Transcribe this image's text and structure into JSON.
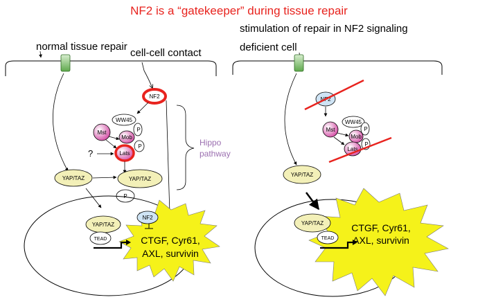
{
  "title": "NF2 is a “gatekeeper” during tissue repair",
  "left_panel": {
    "heading": "normal tissue repair",
    "contact_label": "cell-cell contact",
    "nf2": "NF2",
    "ww45": "WW45",
    "mst": "Mst",
    "mob": "Mob",
    "lats": "Lats",
    "p1": "P",
    "p2": "P",
    "p3": "P",
    "question": "?",
    "yaptaz_cyto": "YAP/TAZ",
    "yaptaz_phos": "YAP/TAZ",
    "yaptaz_nuc": "YAP/TAZ",
    "nf2_nuc": "NF2",
    "tead": "TEAD",
    "hippo_line1": "Hippo",
    "hippo_line2": "pathway",
    "targets": [
      "CTGF, Cyr61,",
      "AXL, survivin"
    ]
  },
  "right_panel": {
    "heading_line1": "stimulation of repair in NF2 signaling",
    "heading_line2": "deficient cell",
    "nf2": "NF2",
    "ww45": "WW45",
    "mst": "Mst",
    "mob": "Mob",
    "lats": "Lats",
    "p1": "P",
    "p2": "P",
    "yaptaz_cyto": "YAP/TAZ",
    "yaptaz_nuc": "YAP/TAZ",
    "tead": "TEAD",
    "targets": [
      "CTGF, Cyr61,",
      "AXL, survivin"
    ]
  },
  "colors": {
    "title": "#e8231e",
    "hippo": "#9b6fb0",
    "starburst": "#f5f21a",
    "nf2_ring": "#e8231e",
    "inactivation_line": "#e8231e",
    "receptor": "#8fc87e",
    "yaptaz": "#f3f0b8",
    "nf2_deficient": "#cfe4f5",
    "kinase_pink": "#d44fa6"
  }
}
